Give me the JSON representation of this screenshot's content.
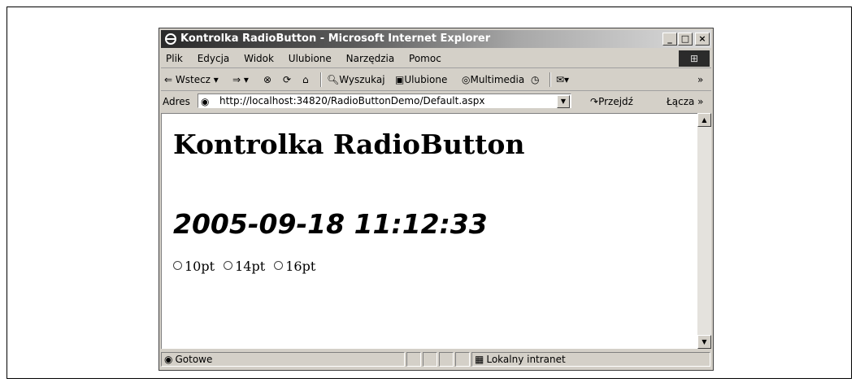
{
  "window": {
    "title": "Kontrolka RadioButton - Microsoft Internet Explorer",
    "controls": {
      "minimize": "_",
      "maximize": "□",
      "close": "×"
    }
  },
  "menu": {
    "items": [
      "Plik",
      "Edycja",
      "Widok",
      "Ulubione",
      "Narzędzia",
      "Pomoc"
    ]
  },
  "toolbar": {
    "back": "Wstecz",
    "search": "Wyszukaj",
    "favorites": "Ulubione",
    "media": "Multimedia",
    "more": "»"
  },
  "address": {
    "label": "Adres",
    "url": "http://localhost:34820/RadioButtonDemo/Default.aspx",
    "go": "Przejdź",
    "links": "Łącza »"
  },
  "page": {
    "heading": "Kontrolka RadioButton",
    "timestamp": "2005-09-18 11:12:33",
    "radios": [
      "10pt",
      "14pt",
      "16pt"
    ]
  },
  "status": {
    "text": "Gotowe",
    "zone": "Lokalny intranet"
  }
}
